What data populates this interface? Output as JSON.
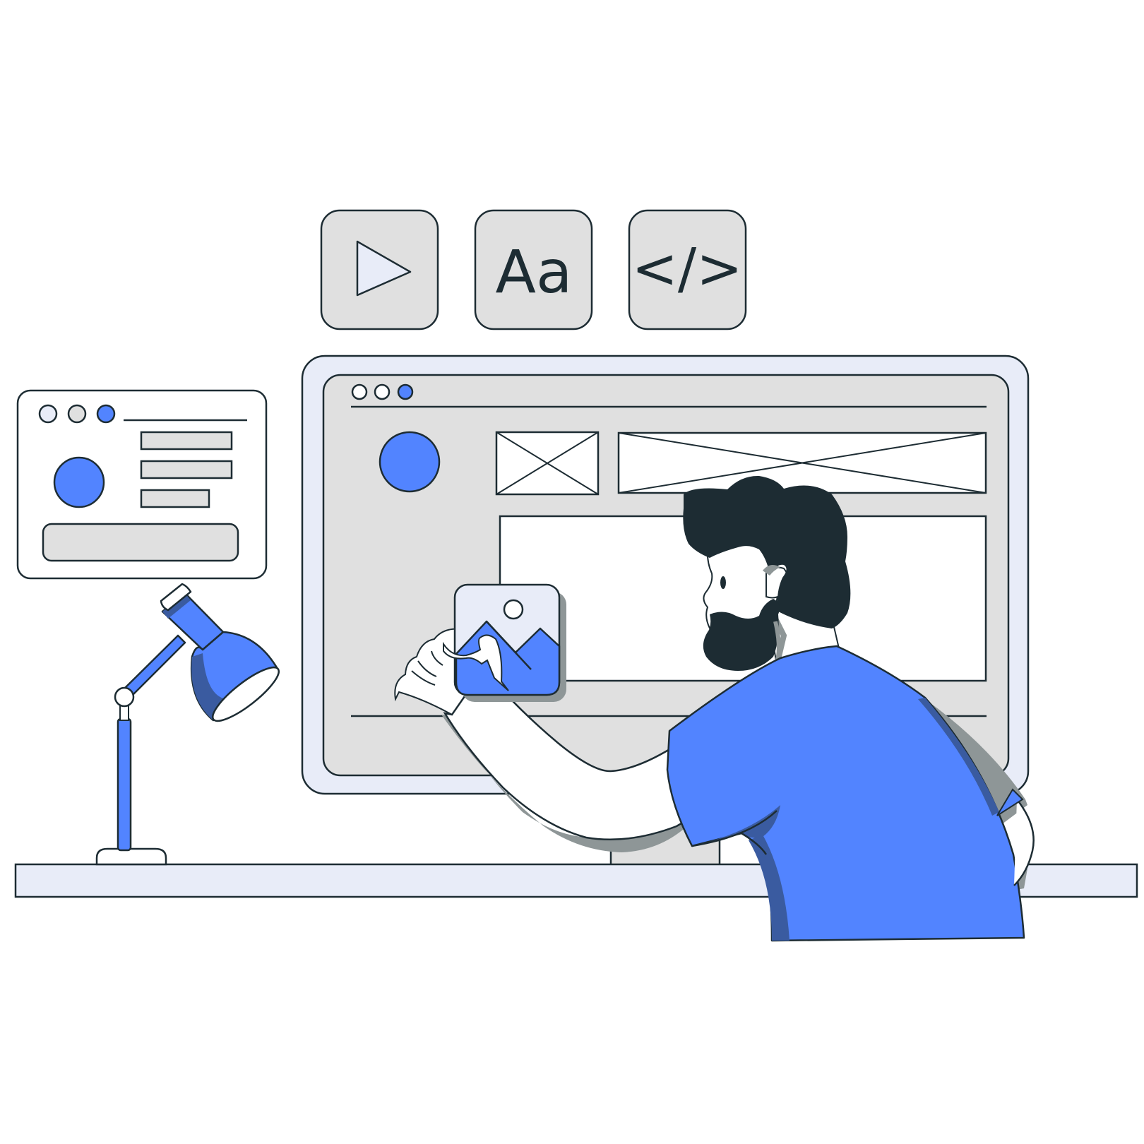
{
  "tiles": {
    "media": {
      "icon": "play-icon"
    },
    "typography": {
      "label": "Aa",
      "icon": "typography-icon"
    },
    "code": {
      "label": "</>",
      "icon": "code-icon"
    }
  },
  "colors": {
    "outline": "#1d2c33",
    "accent": "#5284ff",
    "accent_dark": "#3a5ba0",
    "panel_gray": "#e0e0e0",
    "frame_light": "#e8ecf8",
    "shadow_gray": "#8e9697",
    "white": "#ffffff"
  }
}
